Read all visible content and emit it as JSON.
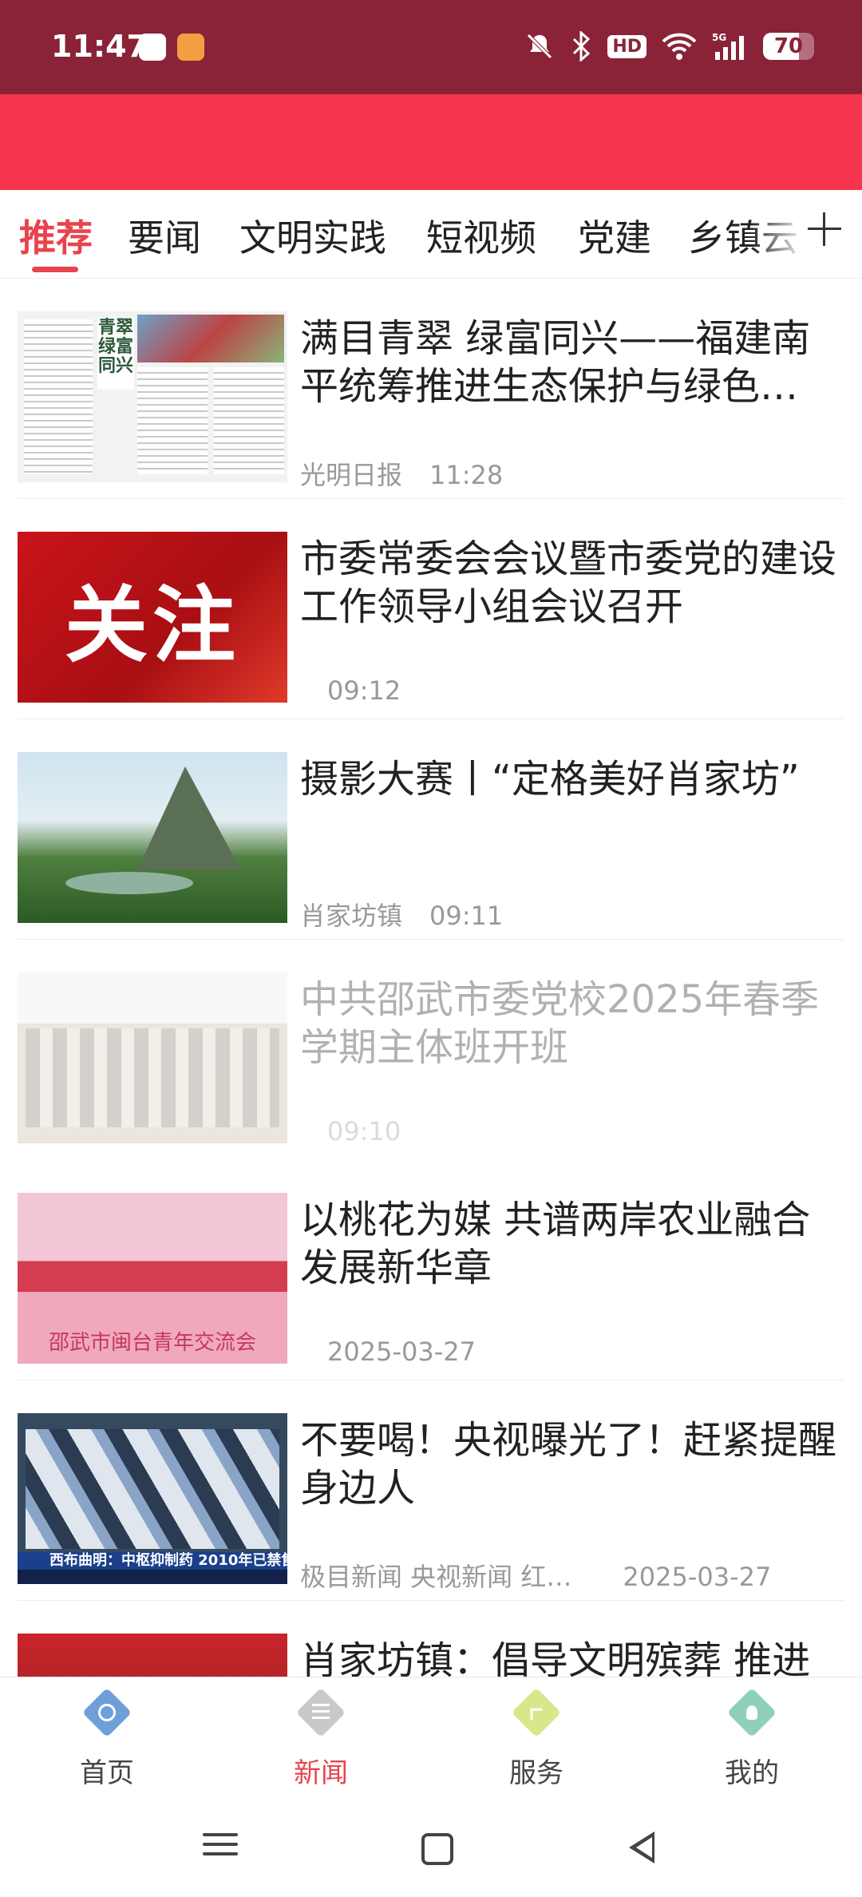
{
  "status_bar": {
    "time": "11:47",
    "battery": "70",
    "hd": "HD",
    "network": "5G"
  },
  "tabs": [
    {
      "label": "推荐",
      "active": true
    },
    {
      "label": "要闻"
    },
    {
      "label": "文明实践"
    },
    {
      "label": "短视频"
    },
    {
      "label": "党建"
    },
    {
      "label": "乡镇云"
    }
  ],
  "news": [
    {
      "title": "满目青翠 绿富同兴——福建南平统筹推进生态保护与绿色…",
      "source": "光明日报",
      "time": "11:28",
      "thumb_headline": "青翠绿富同兴"
    },
    {
      "title": "市委常委会会议暨市委党的建设工作领导小组会议召开",
      "source": "",
      "time": "09:12",
      "thumb_text": "关注"
    },
    {
      "title": "摄影大赛丨“定格美好肖家坊”",
      "source": "肖家坊镇",
      "time": "09:11"
    },
    {
      "title": "中共邵武市委党校2025年春季学期主体班开班",
      "source": "",
      "time": "09:10"
    },
    {
      "title": "以桃花为媒 共谱两岸农业融合发展新华章",
      "source": "",
      "time": "2025-03-27",
      "thumb_text": "邵武市闽台青年交流会"
    },
    {
      "title": "不要喝！央视曝光了！赶紧提醒身边人",
      "source": "极目新闻 央视新闻 红…",
      "time": "2025-03-27",
      "thumb_caption": "西布曲明：中枢抑制药 2010年已禁售"
    },
    {
      "title": "肖家坊镇：倡导文明殡葬 推进",
      "source": "",
      "time": ""
    }
  ],
  "bottom_nav": [
    {
      "label": "首页",
      "icon": "globe-icon",
      "color": "#6f9fd8"
    },
    {
      "label": "新闻",
      "icon": "list-icon",
      "color": "#b9b9b9",
      "active": true
    },
    {
      "label": "服务",
      "icon": "share-icon",
      "color": "#d6e88a"
    },
    {
      "label": "我的",
      "icon": "user-icon",
      "color": "#8fd1b8"
    }
  ],
  "colors": {
    "status_bar": "#8a2338",
    "header": "#f5344e",
    "accent": "#e8434e"
  }
}
